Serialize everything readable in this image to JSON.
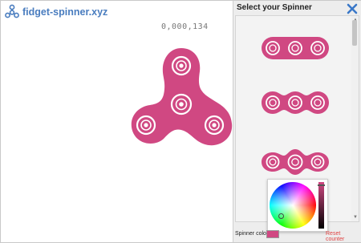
{
  "app": {
    "logo_text": "fidget-spinner.xyz",
    "logo_icon": "spinner-logo-icon",
    "counter": "0,000,134"
  },
  "spinner": {
    "color": "#d04882",
    "bearing_color": "#ffffff",
    "type": "tri-spinner"
  },
  "panel": {
    "title": "Select your Spinner",
    "close_icon": "close-icon",
    "options": [
      {
        "id": "triple-bar-1"
      },
      {
        "id": "triple-bar-2"
      },
      {
        "id": "triple-bar-3"
      }
    ]
  },
  "color_picker": {
    "selected_color": "#d04882"
  },
  "footer": {
    "color_label": "Spinner color",
    "reset_label": "Reset counter"
  }
}
